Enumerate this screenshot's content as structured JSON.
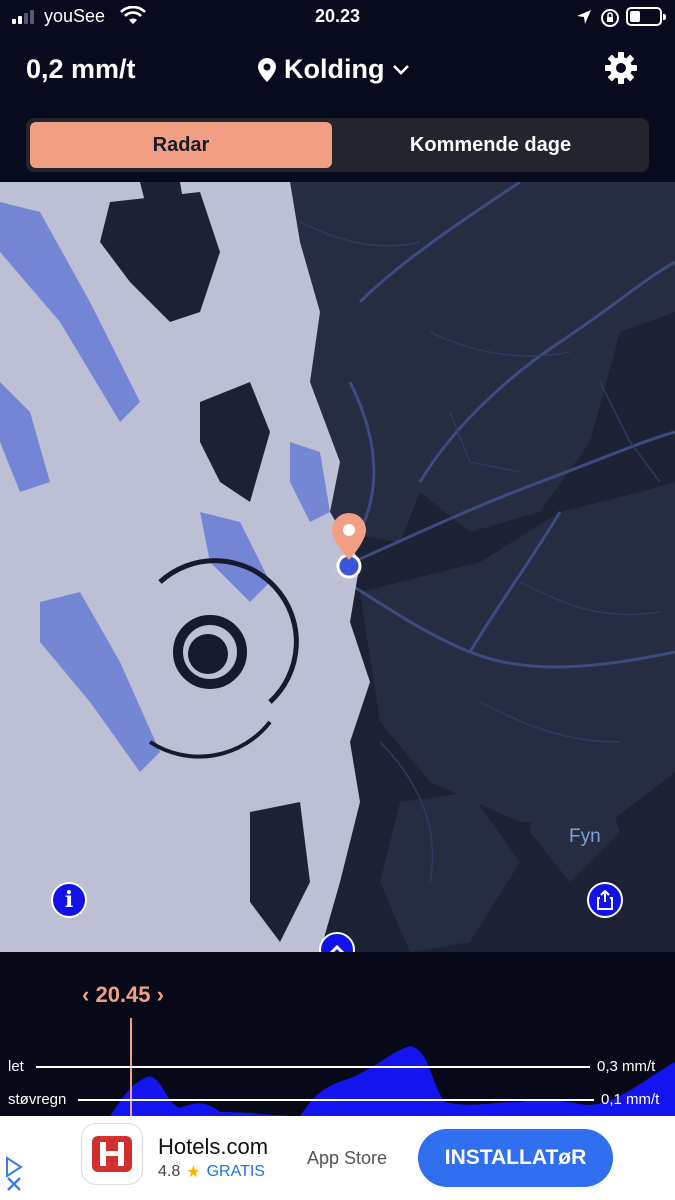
{
  "status_bar": {
    "carrier": "youSee",
    "time": "20.23",
    "signal_bars": 4,
    "signal_bars_active": 2,
    "battery_level": 0.35
  },
  "header": {
    "rate": "0,2 mm/t",
    "location": "Kolding",
    "icons": [
      "location-pin-icon",
      "chevron-down-icon",
      "gear-icon"
    ]
  },
  "tabs": [
    {
      "label": "Radar",
      "active": true
    },
    {
      "label": "Kommende dage",
      "active": false
    }
  ],
  "map": {
    "place_label": "Fyn",
    "colors": {
      "water": "#1c2133",
      "land": "#2a3148",
      "roads": "#3a4a78",
      "rain_light": "#c9cce0",
      "rain_heavy": "#3b55d6",
      "marker": "#f29e84"
    }
  },
  "timeline": {
    "time": "20.45",
    "levels": [
      {
        "name": "let",
        "value": "0,3 mm/t"
      },
      {
        "name": "støvregn",
        "value": "0,1 mm/t"
      }
    ],
    "colors": {
      "precip": "#1414f0",
      "cursor": "#f29e84"
    }
  },
  "ad": {
    "title": "Hotels.com",
    "rating": "4.8",
    "star": "★",
    "price": "GRATIS",
    "store": "App Store",
    "cta": "INSTALLATøR"
  }
}
